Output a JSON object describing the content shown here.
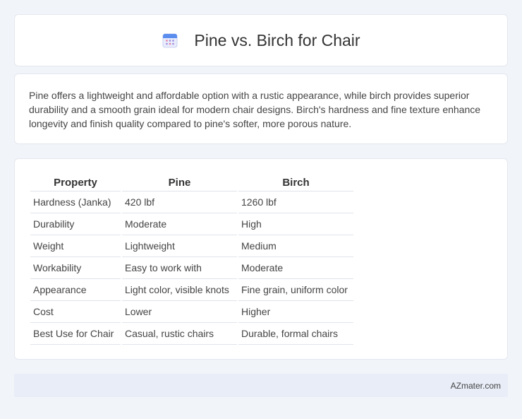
{
  "header": {
    "title": "Pine vs. Birch for Chair",
    "icon": "calendar-icon"
  },
  "summary": {
    "text": "Pine offers a lightweight and affordable option with a rustic appearance, while birch provides superior durability and a smooth grain ideal for modern chair designs. Birch's hardness and fine texture enhance longevity and finish quality compared to pine's softer, more porous nature."
  },
  "table": {
    "headers": [
      "Property",
      "Pine",
      "Birch"
    ],
    "rows": [
      [
        "Hardness (Janka)",
        "420 lbf",
        "1260 lbf"
      ],
      [
        "Durability",
        "Moderate",
        "High"
      ],
      [
        "Weight",
        "Lightweight",
        "Medium"
      ],
      [
        "Workability",
        "Easy to work with",
        "Moderate"
      ],
      [
        "Appearance",
        "Light color, visible knots",
        "Fine grain, uniform color"
      ],
      [
        "Cost",
        "Lower",
        "Higher"
      ],
      [
        "Best Use for Chair",
        "Casual, rustic chairs",
        "Durable, formal chairs"
      ]
    ]
  },
  "footer": {
    "text": "AZmater.com"
  }
}
